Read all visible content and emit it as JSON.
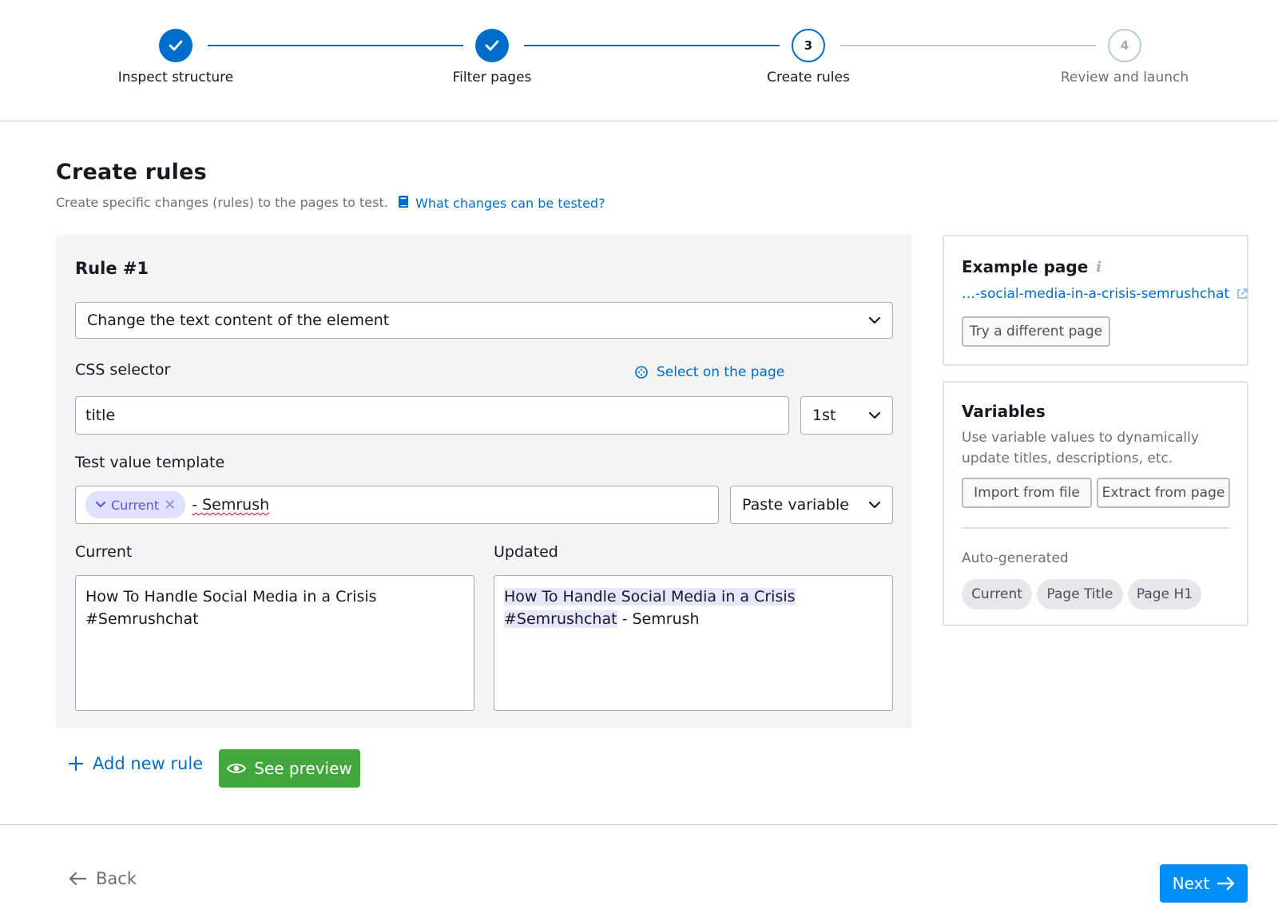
{
  "stepper": {
    "steps": [
      {
        "number": "1",
        "label": "Inspect structure",
        "status": "done"
      },
      {
        "number": "2",
        "label": "Filter pages",
        "status": "done"
      },
      {
        "number": "3",
        "label": "Create rules",
        "status": "active"
      },
      {
        "number": "4",
        "label": "Review and launch",
        "status": "todo"
      }
    ]
  },
  "page": {
    "title": "Create rules",
    "subtitle": "Create specific changes (rules) to the pages to test.",
    "help_link": "What changes can be tested?"
  },
  "rule": {
    "title": "Rule #1",
    "change_type": "Change the text content of the element",
    "css_selector_label": "CSS selector",
    "select_on_page": "Select on the page",
    "css_selector_value": "title",
    "occurrence": "1st",
    "template_label": "Test value template",
    "template_chip": "Current",
    "template_suffix": "- Semrush",
    "paste_variable": "Paste variable",
    "current_label": "Current",
    "updated_label": "Updated",
    "current_value": "How To Handle Social Media in a Crisis #Semrushchat",
    "updated_line1_hl": "How To Handle Social Media in a Crisis",
    "updated_line2_hl": "#Semrushchat",
    "updated_suffix": " - Semrush"
  },
  "actions": {
    "add_rule": "Add new rule",
    "see_preview": "See preview",
    "back": "Back",
    "next": "Next"
  },
  "example_page": {
    "title": "Example page",
    "url": "…-social-media-in-a-crisis-semrushchat",
    "try_different": "Try a different page"
  },
  "variables": {
    "title": "Variables",
    "description": "Use variable values to dynamically update titles, descriptions, etc.",
    "import_file": "Import from file",
    "extract_page": "Extract from page",
    "auto_label": "Auto-generated",
    "pills": [
      "Current",
      "Page Title",
      "Page H1"
    ]
  },
  "colors": {
    "primary": "#006dca",
    "success": "#42a73c",
    "next": "#008ff8",
    "chip_bg": "#e0e1fd",
    "chip_text": "#5c58c8"
  }
}
